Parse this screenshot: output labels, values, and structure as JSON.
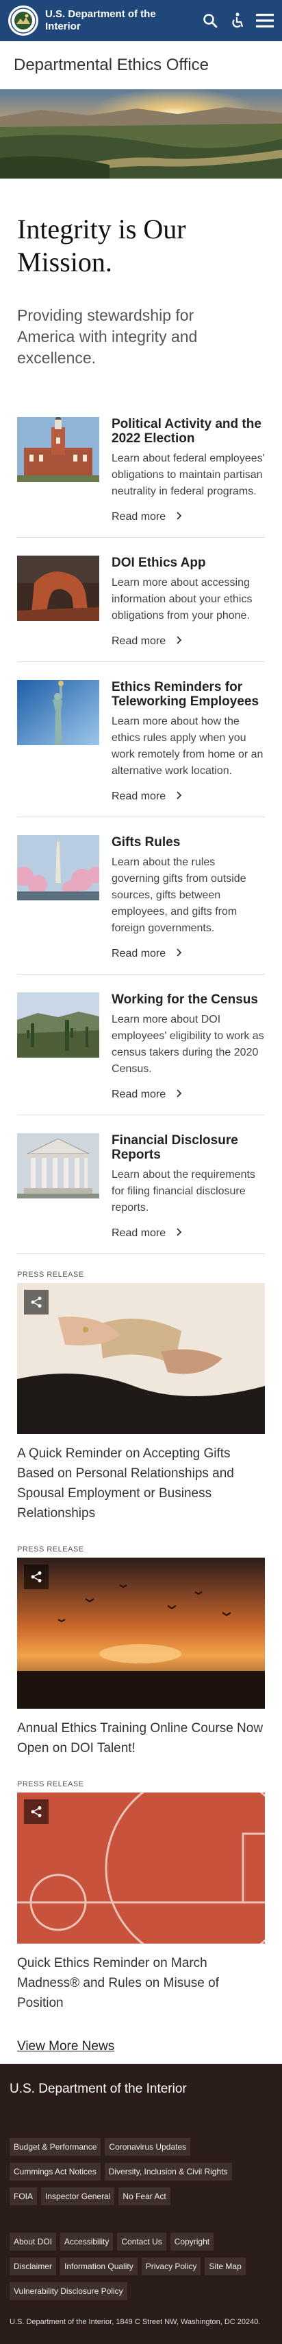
{
  "header": {
    "agency_name": "U.S. Department of the Interior",
    "icons": [
      "search-icon",
      "accessibility-icon",
      "menu-icon"
    ],
    "colors": {
      "bar": "#20477a"
    }
  },
  "office": {
    "title": "Departmental Ethics Office"
  },
  "mission": {
    "heading": "Integrity is Our Mission.",
    "subheading": "Providing stewardship for America with integrity and excellence."
  },
  "cards": [
    {
      "title": "Political Activity and the 2022 Election",
      "text": "Learn about federal employees' obligations to maintain partisan neutrality in federal programs.",
      "more": "Read more"
    },
    {
      "title": "DOI Ethics App",
      "text": "Learn more about accessing information about your ethics obligations from your phone.",
      "more": "Read more"
    },
    {
      "title": "Ethics Reminders for Teleworking Employees",
      "text": "Learn more about how the ethics rules apply when you work remotely from home or an alternative work location.",
      "more": "Read more"
    },
    {
      "title": "Gifts Rules",
      "text": "Learn about the rules governing gifts from outside sources, gifts between employees, and gifts from foreign governments.",
      "more": "Read more"
    },
    {
      "title": "Working for the Census",
      "text": "Learn more about DOI employees' eligibility to work as census takers during the 2020 Census.",
      "more": "Read more"
    },
    {
      "title": "Financial Disclosure Reports",
      "text": "Learn about the requirements for filing financial disclosure reports.",
      "more": "Read more"
    }
  ],
  "press": [
    {
      "tag": "PRESS RELEASE",
      "title": "A Quick Reminder on Accepting Gifts Based on Personal Relationships and Spousal Employment or Business Relationships"
    },
    {
      "tag": "PRESS RELEASE",
      "title": "Annual Ethics Training Online Course Now Open on DOI Talent!"
    },
    {
      "tag": "PRESS RELEASE",
      "title": "Quick Ethics Reminder on March Madness® and Rules on Misuse of Position"
    }
  ],
  "view_more": "View More News",
  "footer": {
    "title": "U.S. Department of the Interior",
    "links_row1": [
      "Budget & Performance",
      "Coronavirus Updates"
    ],
    "links_row2": [
      "Cummings Act Notices",
      "Diversity, Inclusion & Civil Rights"
    ],
    "links_row3": [
      "FOIA",
      "Inspector General",
      "No Fear Act"
    ],
    "links_row4": [
      "About DOI",
      "Accessibility",
      "Contact Us",
      "Copyright"
    ],
    "links_row5": [
      "Disclaimer",
      "Information Quality",
      "Privacy Policy",
      "Site Map"
    ],
    "links_row6": [
      "Vulnerability Disclosure Policy"
    ],
    "address": "U.S. Department of the Interior, 1849 C Street NW, Washington, DC 20240.",
    "colors": {
      "background": "#2a1d1a",
      "chip": "#3f302c"
    }
  }
}
